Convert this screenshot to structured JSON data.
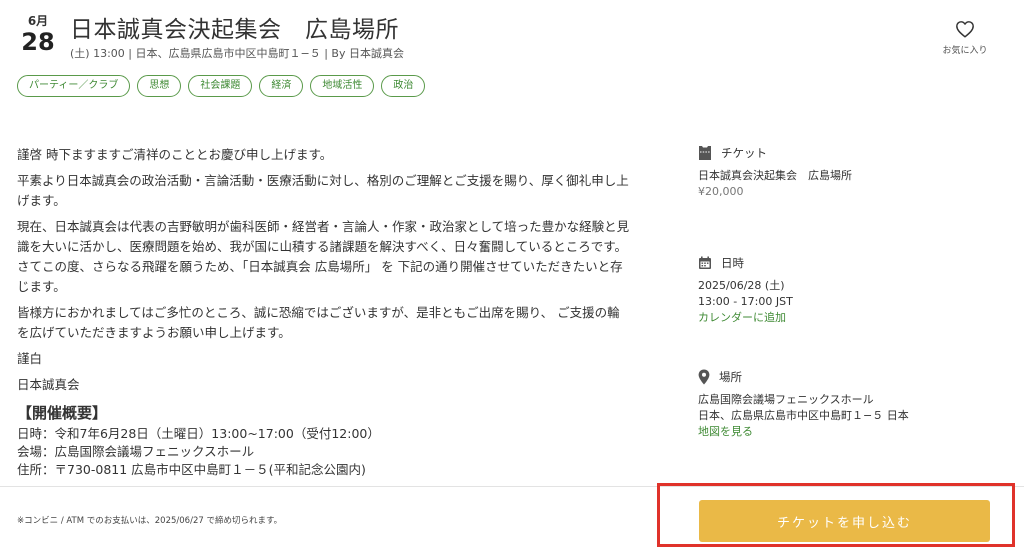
{
  "event": {
    "month": "6月",
    "day": "28",
    "title": "日本誠真会決起集会　広島場所",
    "subtitle": "(土) 13:00 | 日本、広島県広島市中区中島町１−５ | By 日本誠真会"
  },
  "favorite": {
    "label": "お気に入り"
  },
  "tags": [
    "パーティー／クラブ",
    "思想",
    "社会課題",
    "経済",
    "地域活性",
    "政治"
  ],
  "body": {
    "p1": "謹啓 時下ますますご清祥のこととお慶び申し上げます。",
    "p2": "平素より日本誠真会の政治活動・言論活動・医療活動に対し、格別のご理解とご支援を賜り、厚く御礼申し上げます。",
    "p3": "現在、日本誠真会は代表の吉野敏明が歯科医師・経営者・言論人・作家・政治家として培った豊かな経験と見識を大いに活かし、医療問題を始め、我が国に山積する諸課題を解決すべく、日々奮闘しているところです。 さてこの度、さらなる飛躍を願うため、「日本誠真会 広島場所」 を 下記の通り開催させていただきたいと存じます。",
    "p4": "皆様方におかれましてはご多忙のところ、誠に恐縮ではございますが、是非ともご出席を賜り、 ご支援の輪を広げていただきますようお願い申し上げます。",
    "p5": "謹白",
    "p6": "日本誠真会",
    "heading": "【開催概要】",
    "detail_date": "日時：令和7年6月28日（土曜日）13:00~17:00（受付12:00）",
    "detail_venue": "会場：広島国際会議場フェニックスホール",
    "detail_address": "住所：〒730-0811 広島市中区中島町１－５(平和記念公園内)"
  },
  "sidebar": {
    "ticket": {
      "heading": "チケット",
      "name": "日本誠真会決起集会　広島場所",
      "price": "¥20,000"
    },
    "datetime": {
      "heading": "日時",
      "date": "2025/06/28 (土)",
      "time": "13:00 - 17:00 JST",
      "link": "カレンダーに追加"
    },
    "place": {
      "heading": "場所",
      "venue": "広島国際会議場フェニックスホール",
      "address": "日本、広島県広島市中区中島町１−５ 日本",
      "link": "地図を見る"
    }
  },
  "footer": {
    "note": "※コンビニ / ATM でのお支払いは、2025/06/27 で締め切られます。",
    "cta_label": "チケットを申し込む"
  },
  "colors": {
    "accent_green": "#3f8a34",
    "cta_yellow": "#eab947",
    "highlight_red": "#e0322a"
  }
}
